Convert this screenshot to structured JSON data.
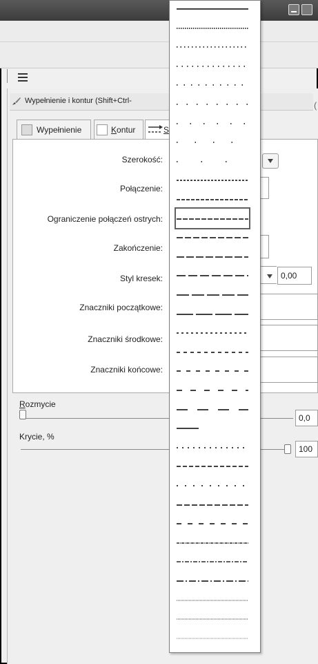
{
  "panel": {
    "title": "Wypełnienie i kontur (Shift+Ctrl-"
  },
  "tabs": {
    "fill": "Wypełnienie",
    "stroke_paint_prefix": "K",
    "stroke_paint_rest": "ontur",
    "stroke_style": "S"
  },
  "fields": {
    "width": "Szerokość:",
    "join": "Połączenie:",
    "miter_limit": "Ograniczenie połączeń ostrych:",
    "cap": "Zakończenie:",
    "dashes": "Styl kresek:",
    "start_markers": "Znaczniki początkowe:",
    "mid_markers": "Znaczniki środkowe:",
    "end_markers": "Znaczniki końcowe:",
    "dash_offset_value": "0,00"
  },
  "sliders": {
    "blur_label_prefix": "R",
    "blur_label_rest": "ozmycie",
    "blur_value": "0,0",
    "opacity_label": "Krycie, %",
    "opacity_value": "100"
  },
  "dash_menu": {
    "selected_index": 11,
    "items": [
      {
        "pattern": "solid"
      },
      {
        "pattern": "dotted-dense"
      },
      {
        "pattern": "dotted-1"
      },
      {
        "pattern": "dotted-2"
      },
      {
        "pattern": "dotted-3"
      },
      {
        "pattern": "dotted-4"
      },
      {
        "pattern": "dotted-5"
      },
      {
        "pattern": "dotted-6"
      },
      {
        "pattern": "dotted-7"
      },
      {
        "pattern": "dashed-dense"
      },
      {
        "pattern": "dashed-1"
      },
      {
        "pattern": "dashed-2"
      },
      {
        "pattern": "dashed-3"
      },
      {
        "pattern": "dashed-4"
      },
      {
        "pattern": "dashed-5"
      },
      {
        "pattern": "dashed-6"
      },
      {
        "pattern": "dashed-7"
      },
      {
        "pattern": "dashed-8"
      },
      {
        "pattern": "dashed-9"
      },
      {
        "pattern": "dashed-10"
      },
      {
        "pattern": "dashed-11"
      },
      {
        "pattern": "dashed-12"
      },
      {
        "pattern": "dashed-13"
      },
      {
        "pattern": "dotted-8"
      },
      {
        "pattern": "dashed-14"
      },
      {
        "pattern": "dotted-9"
      },
      {
        "pattern": "dashed-15"
      },
      {
        "pattern": "dashed-16"
      },
      {
        "pattern": "dash-dot-1"
      },
      {
        "pattern": "dash-dot-2"
      },
      {
        "pattern": "dash-dot-3"
      },
      {
        "pattern": "hairline-1"
      },
      {
        "pattern": "hairline-2"
      },
      {
        "pattern": "hairline-3"
      }
    ]
  }
}
